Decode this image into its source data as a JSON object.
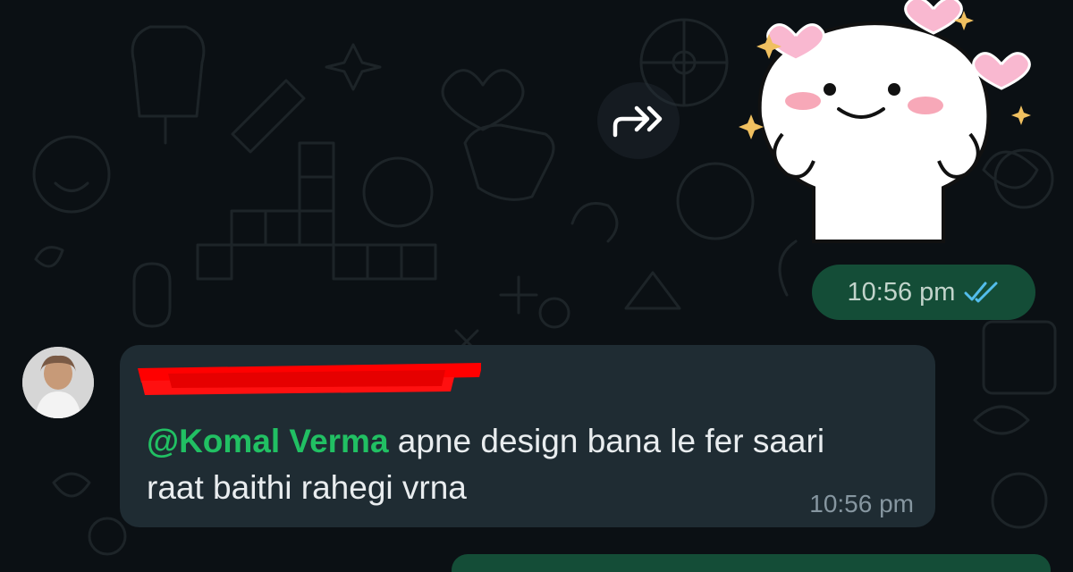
{
  "chat": {
    "outgoing_sticker": {
      "time": "10:56 pm",
      "status_icon": "double-check-read-icon",
      "status_color": "#53bdeb"
    },
    "incoming_message": {
      "sender_name": "",
      "mention": "@Komal Verma",
      "text": " apne design bana le fer saari raat baithi rahegi vrna",
      "time": "10:56 pm"
    }
  },
  "colors": {
    "background": "#0b1014",
    "incoming_bubble": "#1f2c33",
    "outgoing_bubble": "#144d37",
    "mention": "#21c063",
    "redaction": "#ff0000"
  }
}
